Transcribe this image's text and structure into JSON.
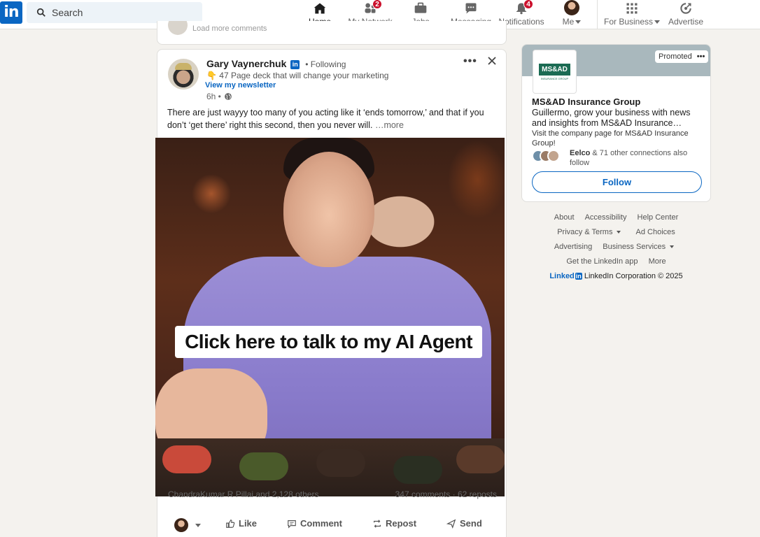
{
  "nav": {
    "logo": "in",
    "search_placeholder": "Search",
    "items": [
      {
        "label": "Home",
        "icon": "home-icon",
        "active": true
      },
      {
        "label": "My Network",
        "icon": "people-icon",
        "badge": "2"
      },
      {
        "label": "Jobs",
        "icon": "briefcase-icon"
      },
      {
        "label": "Messaging",
        "icon": "message-icon"
      },
      {
        "label": "Notifications",
        "icon": "bell-icon",
        "badge": "4"
      },
      {
        "label": "Me",
        "icon": "avatar"
      },
      {
        "label": "For Business",
        "icon": "grid-icon"
      },
      {
        "label": "Advertise",
        "icon": "compass-icon"
      }
    ]
  },
  "prev_card": {
    "text": "Load more comments"
  },
  "post": {
    "author": "Gary Vaynerchuk",
    "badge": "in",
    "following": "• Following",
    "headline": "👇 47 Page deck that will change your marketing",
    "newsletter": "View my newsletter",
    "time": "6h •",
    "text": "There are just wayyy too many of you acting like it ‘ends tomorrow,’ and that if you don’t ‘get there’ right this second, then you never will.",
    "more": "…more",
    "image_cta": "Click here to talk to my AI Agent",
    "reactions": "ChandraKumar R Pillai and 2,128 others",
    "comments": "347 comments · 62 reposts",
    "actions": [
      "Like",
      "Comment",
      "Repost",
      "Send"
    ]
  },
  "ad": {
    "logo_mark": "MS&AD",
    "logo_sub": "INSURANCE GROUP",
    "promoted": "Promoted",
    "company": "MS&AD Insurance Group",
    "body": "Guillermo, grow your business with news and insights from MS&AD Insurance…",
    "sub": "Visit the company page for MS&AD Insurance Group!",
    "connection_name": "Eelco",
    "connections": " & 71 other connections also follow",
    "follow": "Follow"
  },
  "footer": {
    "links_row1": [
      "About",
      "Accessibility",
      "Help Center"
    ],
    "links_row2": [
      "Privacy & Terms",
      "Ad Choices"
    ],
    "links_row3": [
      "Advertising",
      "Business Services"
    ],
    "links_row4": [
      "Get the LinkedIn app",
      "More"
    ],
    "brand": "Linked",
    "brand_in": "in",
    "corp": "LinkedIn Corporation © 2025"
  },
  "colors": {
    "brand": "#0a66c2",
    "badge": "#cb112d",
    "background": "#f4f2ee"
  }
}
